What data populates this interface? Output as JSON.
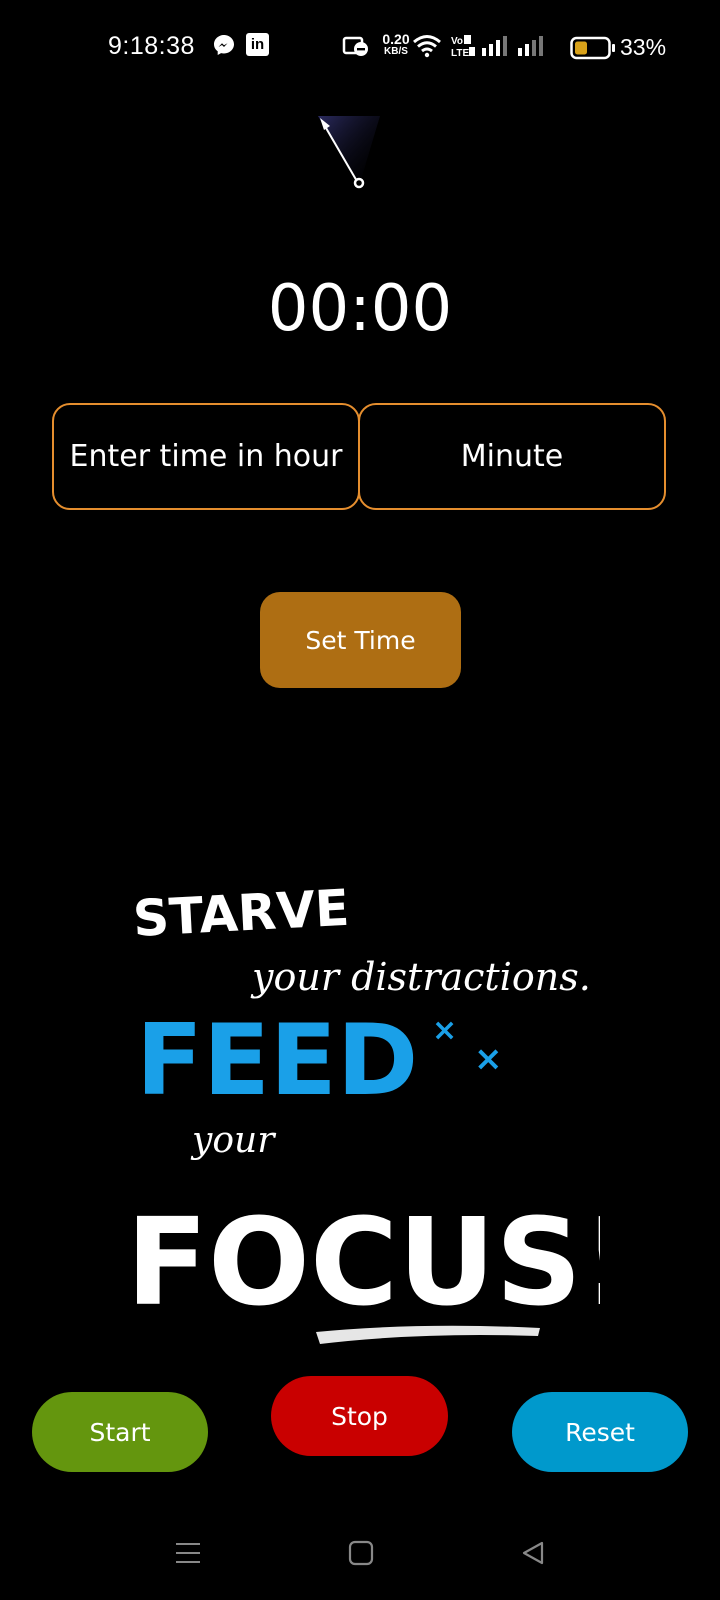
{
  "status_bar": {
    "time": "9:18:38",
    "net_speed_value": "0.20",
    "net_speed_unit": "KB/S",
    "battery_percent": "33%"
  },
  "timer": {
    "display": "00:00"
  },
  "inputs": {
    "hour_placeholder": "Enter time in hour",
    "minute_placeholder": "Minute"
  },
  "buttons": {
    "set_time": "Set Time",
    "start": "Start",
    "stop": "Stop",
    "reset": "Reset"
  },
  "poster": {
    "line1": "STARVE",
    "line2": "your distractions.",
    "line3": "FEED",
    "line4": "your",
    "line5": "FOCUS!"
  },
  "icons": {
    "status": [
      "messenger-icon",
      "linkedin-icon",
      "dnd-icon",
      "wifi-icon",
      "volte-icon",
      "signal-icon",
      "battery-icon"
    ],
    "nav": [
      "menu-icon",
      "home-icon",
      "back-icon"
    ]
  },
  "colors": {
    "background": "#000000",
    "input_border": "#e58e2e",
    "set_time": "#ae6e13",
    "start": "#64960e",
    "stop": "#c90000",
    "reset": "#0099cc",
    "poster_blue": "#1aa0e8"
  }
}
